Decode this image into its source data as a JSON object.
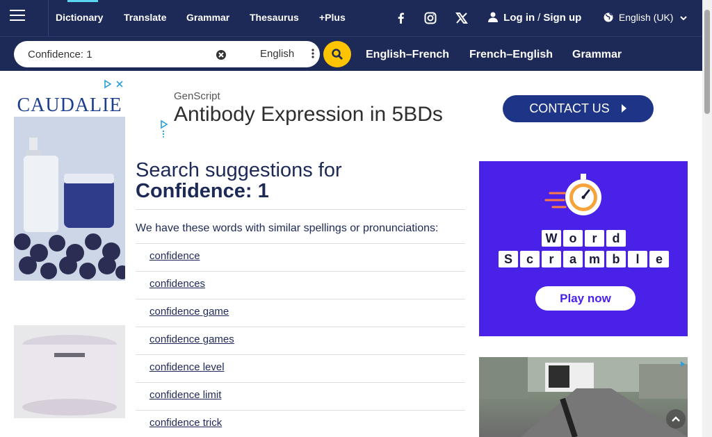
{
  "nav": {
    "links": [
      "Dictionary",
      "Translate",
      "Grammar",
      "Thesaurus",
      "+Plus"
    ],
    "login": "Log in",
    "signup": "Sign up",
    "language": "English (UK)"
  },
  "search": {
    "value": "Confidence: 1",
    "dictionary": "English",
    "tabs": [
      "English–French",
      "French–English",
      "Grammar"
    ]
  },
  "left_ad": {
    "brand": "CAUDALIE"
  },
  "banner_ad": {
    "brand": "GenScript",
    "headline": "Antibody Expression in 5BDs",
    "cta": "CONTACT US"
  },
  "main": {
    "heading_prefix": "Search suggestions for",
    "query": "Confidence: 1",
    "intro": "We have these words with similar spellings or pronunciations:",
    "suggestions": [
      "confidence",
      "confidences",
      "confidence game",
      "confidence games",
      "confidence level",
      "confidence limit",
      "confidence trick"
    ]
  },
  "right_ad": {
    "row1": [
      "W",
      "o",
      "r",
      "d"
    ],
    "row2": [
      "S",
      "c",
      "r",
      "a",
      "m",
      "b",
      "l",
      "e"
    ],
    "cta": "Play now"
  },
  "colors": {
    "nav_bg": "#1d2a57",
    "search_button": "#fec400",
    "word_scramble_bg": "#4a21e8",
    "banner_cta": "#1e3587"
  }
}
